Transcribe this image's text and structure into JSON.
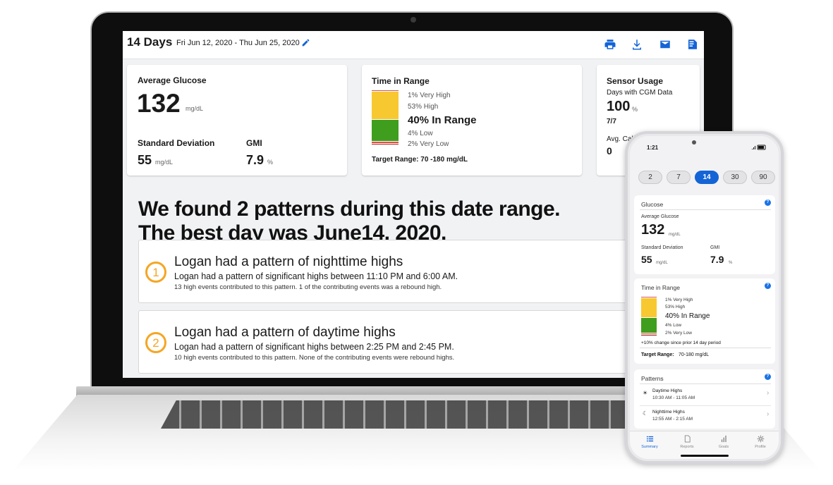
{
  "desktop": {
    "header": {
      "days": "14 Days",
      "date_range": "Fri Jun 12, 2020 - Thu Jun 25, 2020",
      "icons": [
        "print-icon",
        "download-icon",
        "email-icon",
        "export-icon"
      ]
    },
    "glucose_card": {
      "title": "Average Glucose",
      "value": "132",
      "unit": "mg/dL",
      "sd_label": "Standard Deviation",
      "sd_value": "55",
      "sd_unit": "mg/dL",
      "gmi_label": "GMI",
      "gmi_value": "7.9",
      "gmi_unit": "%"
    },
    "tir_card": {
      "title": "Time in Range",
      "very_high": "1% Very High",
      "high": "53% High",
      "in_range": "40% In Range",
      "low": "4% Low",
      "very_low": "2% Very Low",
      "target": "Target Range: 70 -180 mg/dL",
      "segments": [
        {
          "name": "very-high",
          "pct": 1,
          "color": "#d9534f"
        },
        {
          "name": "high",
          "pct": 53,
          "color": "#f7c830"
        },
        {
          "name": "in-range",
          "pct": 40,
          "color": "#3f9e1d"
        },
        {
          "name": "low",
          "pct": 4,
          "color": "#e24a3a"
        },
        {
          "name": "very-low",
          "pct": 2,
          "color": "#a11f17"
        }
      ]
    },
    "sensor_card": {
      "title": "Sensor Usage",
      "days_label": "Days with CGM Data",
      "days_value": "100",
      "days_unit": "%",
      "days_count": "7/7",
      "calib_label": "Avg. Cali",
      "calib_value": "0"
    },
    "patterns": {
      "heading_line1": "We found 2 patterns during this date range.",
      "heading_line2": "The best day was June14, 2020.",
      "items": [
        {
          "num": "1",
          "title": "Logan had a pattern of nighttime highs",
          "line": "Logan had a pattern of significant highs between 11:10 PM and 6:00 AM.",
          "sub": "13 high events contributed to this pattern. 1 of the contributing events was a rebound high."
        },
        {
          "num": "2",
          "title": "Logan had a pattern of daytime highs",
          "line": "Logan had a pattern of significant highs between 2:25 PM and 2:45 PM.",
          "sub": "10 high events contributed to this pattern. None of the contributing events were rebound highs."
        }
      ]
    }
  },
  "phone": {
    "time": "1:21",
    "segments": [
      "2",
      "7",
      "14",
      "30",
      "90"
    ],
    "active_segment": "14",
    "glucose": {
      "title": "Glucose",
      "avg_label": "Average Glucose",
      "avg_value": "132",
      "avg_unit": "mg/dL",
      "sd_label": "Standard Deviation",
      "sd_value": "55",
      "sd_unit": "mg/dL",
      "gmi_label": "GMI",
      "gmi_value": "7.9",
      "gmi_unit": "%"
    },
    "tir": {
      "title": "Time in Range",
      "very_high": "1% Very High",
      "high": "53% High",
      "in_range": "40% In Range",
      "low": "4% Low",
      "very_low": "2% Very Low",
      "change": "+10% change since prior 14 day period",
      "target_label": "Target Range:",
      "target_value": "70-180 mg/dL"
    },
    "patterns": {
      "title": "Patterns",
      "items": [
        {
          "name": "Daytime Highs",
          "time": "10:30 AM - 11:05 AM",
          "icon": "sun-icon"
        },
        {
          "name": "Nighttime Highs",
          "time": "12:55 AM - 2:15 AM",
          "icon": "moon-icon"
        }
      ]
    },
    "tabs": [
      "Summary",
      "Reports",
      "Goals",
      "Profile"
    ],
    "active_tab": "Summary",
    "accent": "#1464d6"
  }
}
